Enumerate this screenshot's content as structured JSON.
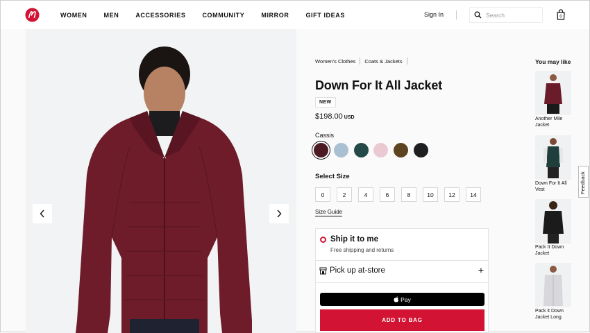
{
  "header": {
    "nav": [
      "WOMEN",
      "MEN",
      "ACCESSORIES",
      "COMMUNITY",
      "MIRROR",
      "GIFT IDEAS"
    ],
    "sign_in": "Sign In",
    "search_placeholder": "Search",
    "brand_color": "#d31334"
  },
  "breadcrumbs": [
    "Women's Clothes",
    "Coats & Jackets"
  ],
  "product": {
    "title": "Down For It All Jacket",
    "badge": "NEW",
    "price": "$198.00",
    "currency": "USD",
    "color_name": "Cassis",
    "swatches": [
      "#4b1a22",
      "#a9c0d2",
      "#234a48",
      "#eac9d2",
      "#5c4420",
      "#1e1f21"
    ],
    "selected_swatch": 0,
    "size_label": "Select Size",
    "sizes": [
      "0",
      "2",
      "4",
      "6",
      "8",
      "10",
      "12",
      "14"
    ],
    "size_guide": "Size Guide"
  },
  "shipping": {
    "ship_title": "Ship it to me",
    "ship_sub": "Free shipping and returns",
    "pickup_title": "Pick up at-store",
    "apple_pay": "Pay",
    "add_to_bag": "ADD TO BAG"
  },
  "recommendations": {
    "heading": "You may like",
    "items": [
      {
        "name": "Another Mile Jacket"
      },
      {
        "name": "Down For It All Vest"
      },
      {
        "name": "Pack It Down Jacket"
      },
      {
        "name": "Pack it Down Jacket Long"
      }
    ]
  },
  "feedback": "Feedback"
}
